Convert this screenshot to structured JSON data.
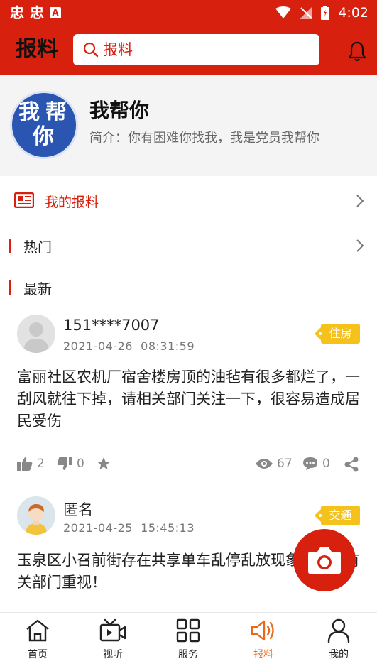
{
  "status_bar": {
    "time": "4:02",
    "app_icon_label": "忠"
  },
  "header": {
    "title": "报料",
    "search_placeholder": "报料"
  },
  "profile": {
    "avatar_text": [
      "我",
      "帮",
      "你"
    ],
    "name": "我帮你",
    "intro": "简介：你有困难你找我，我是党员我帮你"
  },
  "my_report": {
    "label": "我的报料"
  },
  "sections": {
    "hot": "热门",
    "latest": "最新"
  },
  "posts": [
    {
      "user": "151****7007",
      "date": "2021-04-26",
      "time": "08:31:59",
      "tag": "住房",
      "text": "富丽社区农机厂宿舍楼房顶的油毡有很多都烂了，一刮风就往下掉，请相关部门关注一下，很容易造成居民受伤",
      "likes": "2",
      "dislikes": "0",
      "views": "67",
      "comments": "0"
    },
    {
      "user": "匿名",
      "date": "2021-04-25",
      "time": "15:45:13",
      "tag": "交通",
      "text": "玉泉区小召前街存在共享单车乱停乱放现象，希望有关部门重视！"
    }
  ],
  "tabbar": [
    {
      "label": "首页",
      "icon": "home-icon"
    },
    {
      "label": "视听",
      "icon": "video-icon"
    },
    {
      "label": "服务",
      "icon": "grid-icon"
    },
    {
      "label": "报料",
      "icon": "megaphone-icon",
      "active": true
    },
    {
      "label": "我的",
      "icon": "person-icon"
    }
  ],
  "colors": {
    "brand_red": "#d8200f",
    "tag_yellow": "#f5c21b",
    "active_orange": "#e66a1e"
  }
}
